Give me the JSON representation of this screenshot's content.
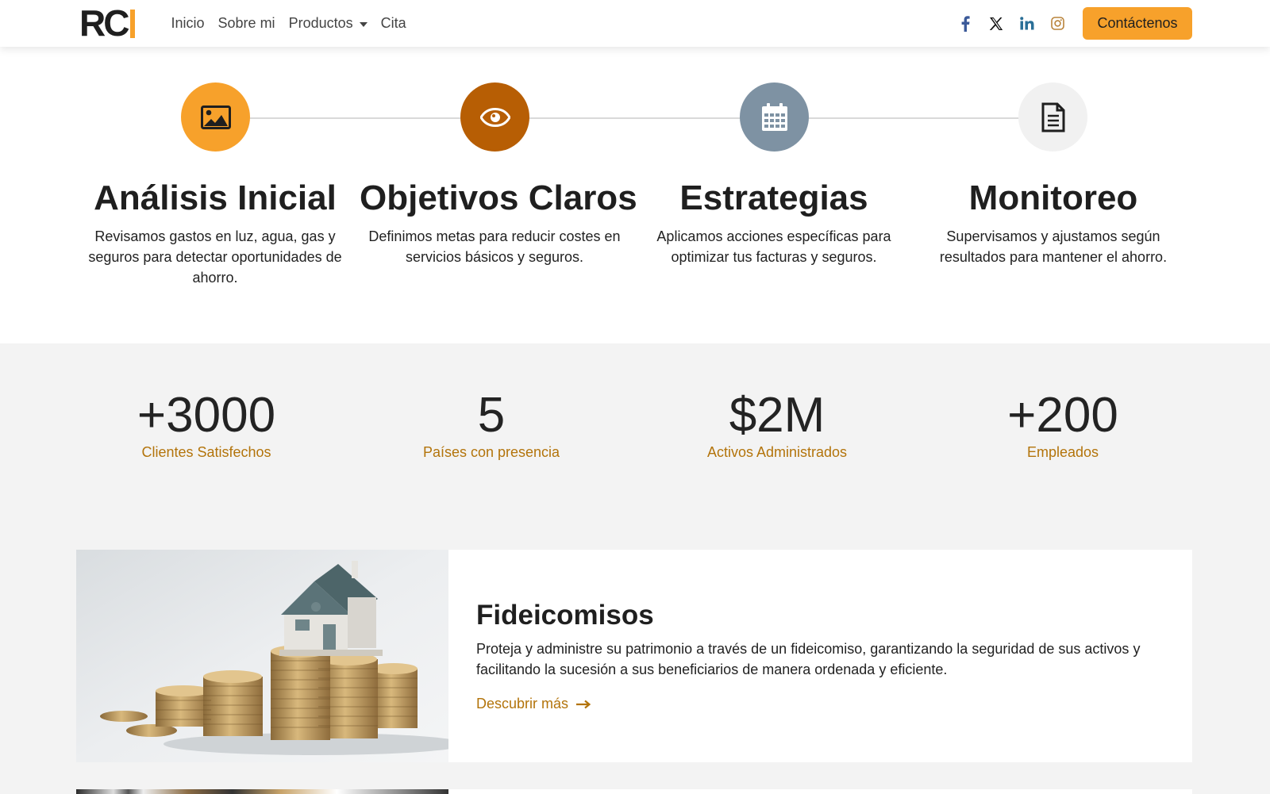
{
  "nav": {
    "logo": "RC",
    "links": [
      "Inicio",
      "Sobre mi",
      "Productos",
      "Cita"
    ],
    "socials": [
      "facebook-icon",
      "x-icon",
      "linkedin-icon",
      "instagram-icon"
    ],
    "cta": "Contáctenos"
  },
  "steps": [
    {
      "icon": "image-icon",
      "color": "#f7a12b",
      "title": "Análisis Inicial",
      "text": "Revisamos gastos en luz, agua, gas y seguros para detectar oportunidades de ahorro."
    },
    {
      "icon": "eye-icon",
      "color": "#b75e04",
      "title": "Objetivos Claros",
      "text": "Definimos metas para reducir costes en servicios básicos y seguros."
    },
    {
      "icon": "calendar-icon",
      "color": "#7e92a3",
      "title": "Estrategias",
      "text": "Aplicamos acciones específicas para optimizar tus facturas y seguros."
    },
    {
      "icon": "document-icon",
      "color": "#f1f1f1",
      "title": "Monitoreo",
      "text": "Supervisamos y ajustamos según resultados para mantener el ahorro."
    }
  ],
  "stats": [
    {
      "value": "+3000",
      "label": "Clientes Satisfechos"
    },
    {
      "value": "5",
      "label": "Países con presencia"
    },
    {
      "value": "$2M",
      "label": "Activos Administrados"
    },
    {
      "value": "+200",
      "label": "Empleados"
    }
  ],
  "card": {
    "title": "Fideicomisos",
    "text": "Proteja y administre su patrimonio a través de un fideicomiso, garantizando la seguridad de sus activos y facilitando la sucesión a sus beneficiarios de manera ordenada y eficiente.",
    "link": "Descubrir más"
  },
  "colors": {
    "accent": "#f7a12b",
    "accent_text": "#b3740b"
  }
}
